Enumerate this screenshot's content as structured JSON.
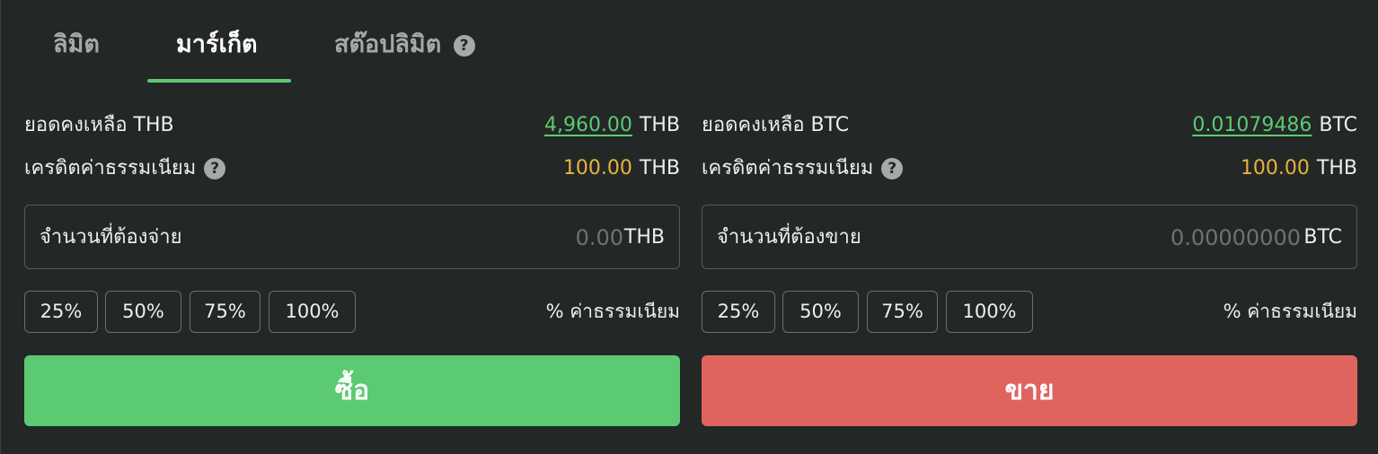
{
  "colors": {
    "background": "#232725",
    "accent_green": "#5cca72",
    "sell_red": "#e0645e",
    "fee_gold": "#e9b23d",
    "balance_green": "#5cca72"
  },
  "tabs": [
    {
      "label": "ลิมิต",
      "active": false
    },
    {
      "label": "มาร์เก็ต",
      "active": true
    },
    {
      "label": "สต๊อปลิมิต",
      "active": false,
      "icon": "help-icon"
    }
  ],
  "help_glyph": "?",
  "buy": {
    "balance_label": "ยอดคงเหลือ THB",
    "balance_value": "4,960.00",
    "balance_unit": "THB",
    "fee_credit_label": "เครดิตค่าธรรมเนียม",
    "fee_credit_value": "100.00",
    "fee_credit_unit": "THB",
    "amount_label": "จำนวนที่ต้องจ่าย",
    "amount_value": "0.00",
    "amount_unit": "THB",
    "percent_buttons": [
      "25%",
      "50%",
      "75%",
      "100%"
    ],
    "fee_note": "% ค่าธรรมเนียม",
    "action_label": "ซื้อ"
  },
  "sell": {
    "balance_label": "ยอดคงเหลือ BTC",
    "balance_value": "0.01079486",
    "balance_unit": "BTC",
    "fee_credit_label": "เครดิตค่าธรรมเนียม",
    "fee_credit_value": "100.00",
    "fee_credit_unit": "THB",
    "amount_label": "จำนวนที่ต้องขาย",
    "amount_value": "0.00000000",
    "amount_unit": "BTC",
    "percent_buttons": [
      "25%",
      "50%",
      "75%",
      "100%"
    ],
    "fee_note": "% ค่าธรรมเนียม",
    "action_label": "ขาย"
  }
}
